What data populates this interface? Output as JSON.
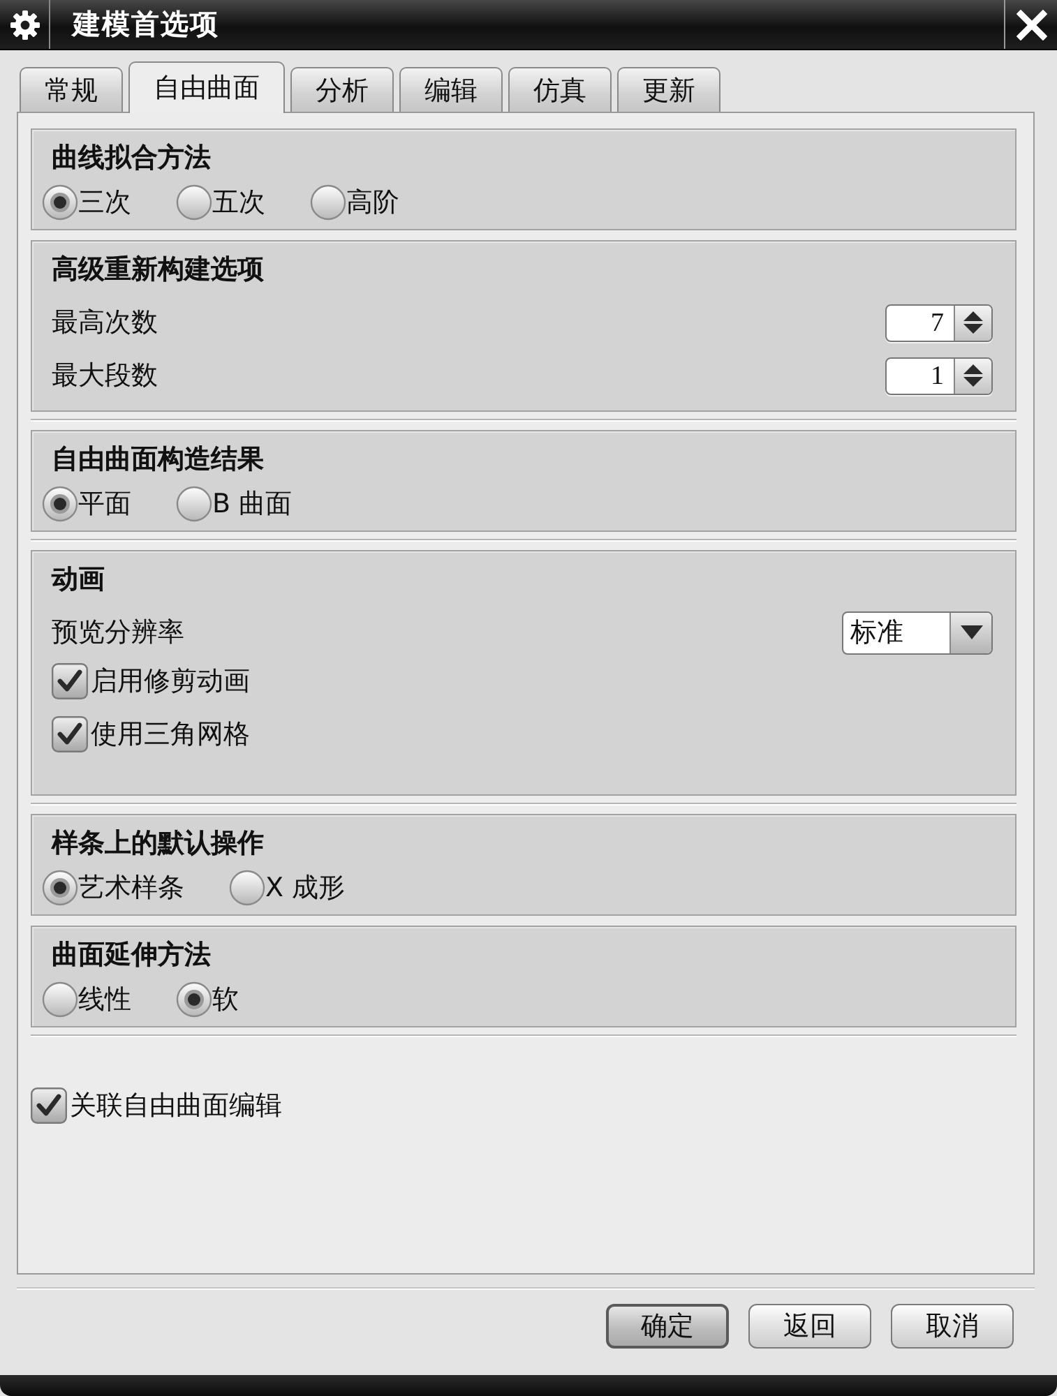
{
  "window": {
    "title": "建模首选项"
  },
  "tabs": [
    {
      "label": "常规",
      "selected": false
    },
    {
      "label": "自由曲面",
      "selected": true
    },
    {
      "label": "分析",
      "selected": false
    },
    {
      "label": "编辑",
      "selected": false
    },
    {
      "label": "仿真",
      "selected": false
    },
    {
      "label": "更新",
      "selected": false
    }
  ],
  "section_groups": [
    {
      "sections": [
        {
          "kind": "radio",
          "title": "曲线拟合方法",
          "options": [
            {
              "label": "三次",
              "selected": true
            },
            {
              "label": "五次",
              "selected": false
            },
            {
              "label": "高阶",
              "selected": false
            }
          ]
        },
        {
          "kind": "fields",
          "title": "高级重新构建选项",
          "rows": [
            {
              "kind": "spinner",
              "label": "最高次数",
              "value": "7"
            },
            {
              "kind": "spinner",
              "label": "最大段数",
              "value": "1"
            }
          ]
        }
      ]
    },
    {
      "sections": [
        {
          "kind": "radio",
          "title": "自由曲面构造结果",
          "options": [
            {
              "label": "平面",
              "selected": true
            },
            {
              "label": "B 曲面",
              "selected": false
            }
          ]
        }
      ]
    },
    {
      "sections": [
        {
          "kind": "fields",
          "title": "动画",
          "rows": [
            {
              "kind": "dropdown",
              "label": "预览分辨率",
              "value": "标准"
            },
            {
              "kind": "checkbox",
              "label": "启用修剪动画",
              "checked": true
            },
            {
              "kind": "checkbox",
              "label": "使用三角网格",
              "checked": true
            }
          ]
        }
      ]
    },
    {
      "sections": [
        {
          "kind": "radio",
          "title": "样条上的默认操作",
          "options": [
            {
              "label": "艺术样条",
              "selected": true
            },
            {
              "label": "X 成形",
              "selected": false
            }
          ]
        },
        {
          "kind": "radio",
          "title": "曲面延伸方法",
          "options": [
            {
              "label": "线性",
              "selected": false
            },
            {
              "label": "软",
              "selected": true
            }
          ]
        }
      ]
    }
  ],
  "associative_edit": {
    "label": "关联自由曲面编辑",
    "checked": true
  },
  "buttons": [
    {
      "label": "确定",
      "default": true
    },
    {
      "label": "返回",
      "default": false
    },
    {
      "label": "取消",
      "default": false
    }
  ]
}
